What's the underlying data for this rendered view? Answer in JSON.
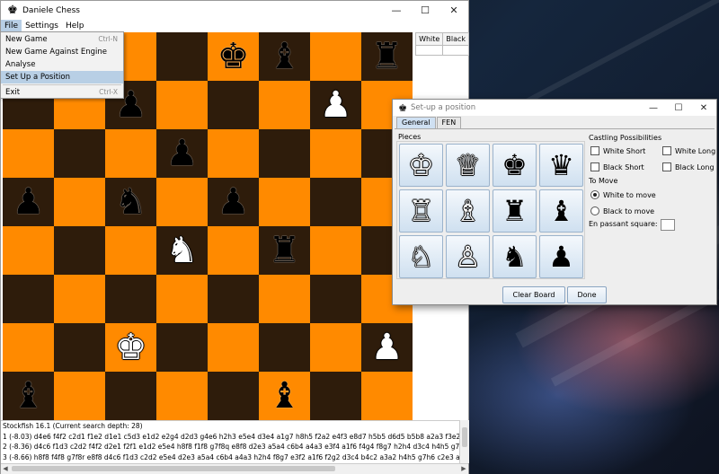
{
  "main_window": {
    "title": "Daniele Chess",
    "menus": [
      "File",
      "Settings",
      "Help"
    ],
    "controls": {
      "minimize": "—",
      "maximize": "☐",
      "close": "✕"
    }
  },
  "file_menu": {
    "items": [
      {
        "label": "New Game",
        "shortcut": "Ctrl-N"
      },
      {
        "label": "New Game Against Engine",
        "shortcut": ""
      },
      {
        "label": "Analyse",
        "shortcut": ""
      },
      {
        "label": "Set Up a Position",
        "shortcut": ""
      },
      {
        "label": "Exit",
        "shortcut": "Ctrl-X"
      }
    ]
  },
  "board": {
    "light_color": "#ff8a00",
    "dark_color": "#2e1c0b",
    "rows": [
      [
        "",
        "",
        "",
        "",
        "bK",
        "bB",
        "",
        "bR"
      ],
      [
        "",
        "",
        "bP",
        "",
        "",
        "",
        "wP",
        ""
      ],
      [
        "",
        "",
        "",
        "bP",
        "",
        "",
        "",
        ""
      ],
      [
        "bP",
        "",
        "bN",
        "",
        "bP",
        "",
        "",
        ""
      ],
      [
        "",
        "",
        "",
        "wN",
        "",
        "bR",
        "",
        ""
      ],
      [
        "",
        "",
        "",
        "",
        "",
        "",
        "",
        ""
      ],
      [
        "",
        "",
        "wK",
        "",
        "",
        "",
        "",
        "wP"
      ],
      [
        "bB",
        "",
        "",
        "",
        "",
        "bB",
        "",
        ""
      ]
    ]
  },
  "moves_table": {
    "headers": [
      "White",
      "Black"
    ]
  },
  "engine": {
    "lines": [
      "Stockfish 16.1 (Current search depth: 28)",
      "1 (-8.03) d4e6 f4f2 c2d1 f1e2 d1e1 c5d3 e1d2 e2g4 d2d3 g4e6 h2h3 e5e4 d3e4 a1g7 h8h5 f2a2 e4f3 e8d7 h5b5 d6d5 b5b8 a2a3 f3e2 d5d4 e2d3",
      "2 (-8.36) d4c6 f1d3 c2d2 f4f2 d2e1 f2f1 e1d2 e5e4 h8f8 f1f8 g7f8q e8f8 d2e3 a5a4 c6b4 a4a3 e3f4 a1f6 f4g4 f8g7 h2h4 d3c4 h4h5 g7h6 b4c2",
      "3 (-8.66) h8f8 f4f8 g7f8r e8f8 d4c6 f1d3 c2d2 e5e4 d2e3 a5a4 c6b4 a4a3 h2h4 f8g7 e3f2 a1f6 f2g2 d3c4 b4c2 a3a2 h4h5 g7h6 c2e3 a2a1q e3c4"
    ]
  },
  "setup_dialog": {
    "title": "Set-up a position",
    "controls": {
      "minimize": "—",
      "maximize": "☐",
      "close": "✕"
    },
    "tabs": [
      "General",
      "FEN"
    ],
    "pieces_label": "Pieces",
    "pieces": [
      {
        "glyph": "♔",
        "color": "w",
        "name": "white-king"
      },
      {
        "glyph": "♕",
        "color": "w",
        "name": "white-queen"
      },
      {
        "glyph": "♚",
        "color": "b",
        "name": "black-king"
      },
      {
        "glyph": "♛",
        "color": "b",
        "name": "black-queen"
      },
      {
        "glyph": "♖",
        "color": "w",
        "name": "white-rook"
      },
      {
        "glyph": "♗",
        "color": "w",
        "name": "white-bishop"
      },
      {
        "glyph": "♜",
        "color": "b",
        "name": "black-rook"
      },
      {
        "glyph": "♝",
        "color": "b",
        "name": "black-bishop"
      },
      {
        "glyph": "♘",
        "color": "w",
        "name": "white-knight"
      },
      {
        "glyph": "♙",
        "color": "w",
        "name": "white-pawn"
      },
      {
        "glyph": "♞",
        "color": "b",
        "name": "black-knight"
      },
      {
        "glyph": "♟",
        "color": "b",
        "name": "black-pawn"
      }
    ],
    "castling_label": "Castling Possibilities",
    "castling": {
      "white_short": "White Short",
      "white_long": "White Long",
      "black_short": "Black Short",
      "black_long": "Black Long"
    },
    "to_move_label": "To Move",
    "to_move": {
      "white": "White to move",
      "black": "Black to move",
      "selected": "white"
    },
    "en_passant_label": "En passant square:",
    "clear_board": "Clear Board",
    "done": "Done"
  }
}
